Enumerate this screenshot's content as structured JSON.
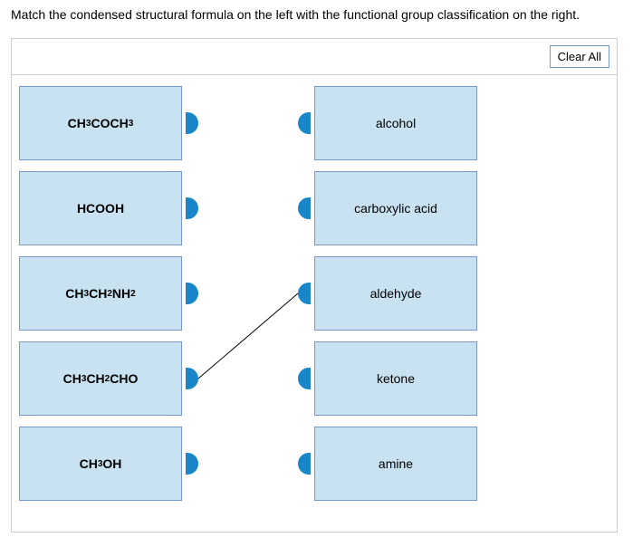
{
  "prompt": "Match the condensed structural formula on the left with the functional group classification on the right.",
  "clear_label": "Clear All",
  "left": [
    {
      "html": "CH<sub>3</sub>COCH<sub>3</sub>"
    },
    {
      "html": "HCOOH"
    },
    {
      "html": "CH<sub>3</sub>CH<sub>2</sub>NH<sub>2</sub>"
    },
    {
      "html": "CH<sub>3</sub>CH<sub>2</sub>CHO"
    },
    {
      "html": "CH<sub>3</sub>OH"
    }
  ],
  "right": [
    {
      "label": "alcohol"
    },
    {
      "label": "carboxylic acid"
    },
    {
      "label": "aldehyde"
    },
    {
      "label": "ketone"
    },
    {
      "label": "amine"
    }
  ],
  "connections": [
    {
      "from_left_index": 3,
      "to_right_index": 2
    }
  ],
  "colors": {
    "card_bg": "#c9e2f2",
    "card_border": "#7898c9",
    "knob": "#1886c9"
  }
}
